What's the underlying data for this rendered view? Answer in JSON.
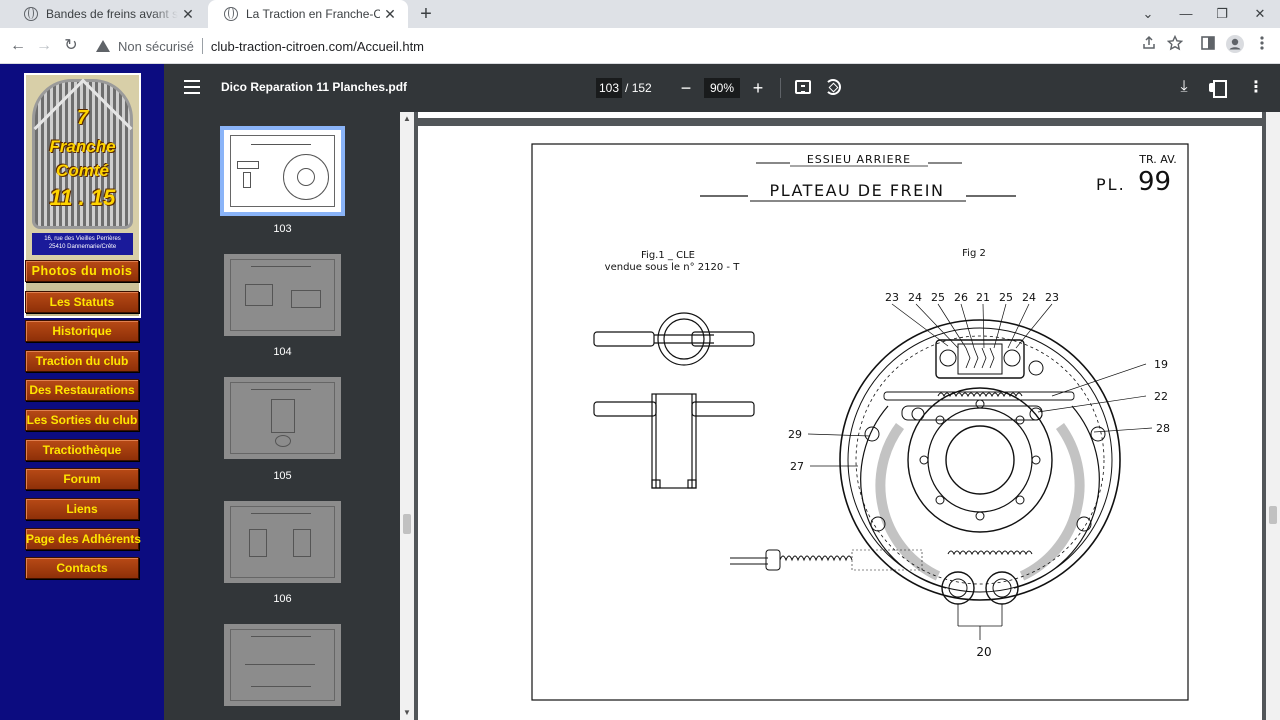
{
  "browser": {
    "tabs": [
      {
        "title": "Bandes de freins avant sens de m",
        "close": "✕"
      },
      {
        "title": "La Traction en Franche-Comté",
        "close": "✕"
      }
    ],
    "new_tab": "+",
    "window_controls": {
      "minimize": "—",
      "maximize": "❐",
      "close": "✕",
      "tab_search": "⌄"
    },
    "nav": {
      "back": "←",
      "forward": "→",
      "reload": "↻"
    },
    "omnibox": {
      "security_label": "Non sécurisé",
      "url": "club-traction-citroen.com/Accueil.htm"
    },
    "toolbar_icons": [
      "share-icon",
      "star-icon",
      "sidebar-icon",
      "profile-icon",
      "menu-icon"
    ]
  },
  "site": {
    "logo": {
      "line1": "7",
      "line2": "Franche",
      "line3": "Comté",
      "line4": "11 . 15",
      "address_line1": "16, rue des Vieilles Perrières",
      "address_line2": "25410 Dannemarie/Crête"
    },
    "menu": [
      "Photos du mois",
      "Les Statuts",
      "Historique",
      "Traction du club",
      "Des Restaurations",
      "Les Sorties du club",
      "Tractiothèque",
      "Forum",
      "Liens",
      "Page des Adhérents",
      "Contacts"
    ]
  },
  "pdf": {
    "title": "Dico Reparation 11 Planches.pdf",
    "current_page": "103",
    "page_separator": "/",
    "total_pages": "152",
    "zoom": "90%",
    "zoom_out": "−",
    "zoom_in": "+",
    "download": "⤓",
    "more": "⋮",
    "thumbnails": [
      "103",
      "104",
      "105",
      "106",
      ""
    ],
    "page": {
      "header_small": "ESSIEU ARRIERE",
      "header_title": "PLATEAU DE FREIN",
      "ref_line": "TR. AV.",
      "plate_prefix": "PL.",
      "plate_number": "99",
      "fig1_title": "Fig.1 _ CLE",
      "fig1_sub": "vendue sous le n° 2120 - T",
      "fig2_title": "Fig  2",
      "callouts_top": [
        "23",
        "24",
        "25",
        "26",
        "21",
        "25",
        "24",
        "23"
      ],
      "callout_19": "19",
      "callout_22": "22",
      "callout_28": "28",
      "callout_29": "29",
      "callout_27": "27",
      "callout_20": "20"
    }
  }
}
